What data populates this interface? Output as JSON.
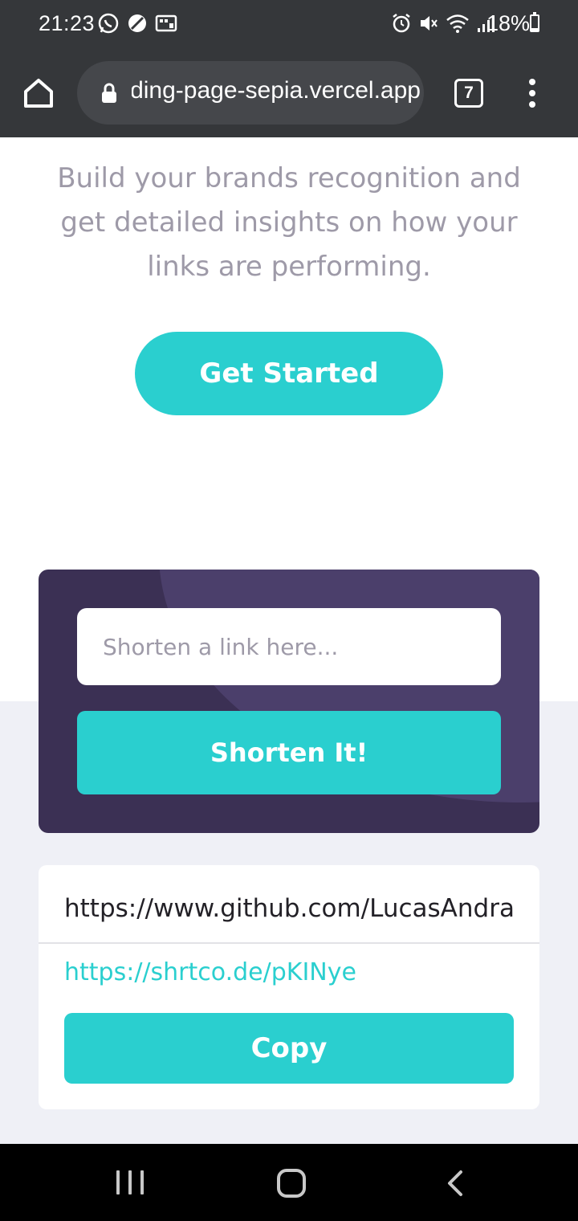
{
  "status_bar": {
    "time": "21:23",
    "left_icons": [
      "whatsapp-icon",
      "blocked-icon",
      "keyboard-icon"
    ],
    "right_icons": [
      "alarm-icon",
      "mute-icon",
      "wifi-icon",
      "signal-icon"
    ],
    "battery_text": "18%",
    "battery_level": 0.18
  },
  "browser": {
    "url": "landing-page-sepia.vercel.app",
    "tab_count": "7"
  },
  "hero": {
    "text": "Build your brands recognition and get detailed insights on how your links are performing.",
    "cta_label": "Get Started"
  },
  "shortener": {
    "placeholder": "Shorten a link here...",
    "button_label": "Shorten It!"
  },
  "result": {
    "original_url": "https://www.github.com/LucasAndrade",
    "short_url": "https://shrtco.de/pKINye",
    "copy_label": "Copy"
  },
  "colors": {
    "accent": "#2acfcf",
    "dark_violet": "#3b3054",
    "gray_text": "#9e9aa8",
    "background_light": "#eff0f6"
  }
}
